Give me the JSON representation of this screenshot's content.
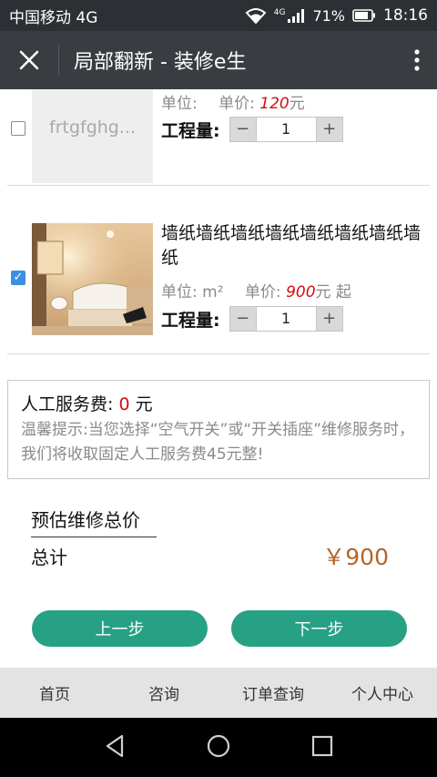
{
  "status_bar": {
    "carrier": "中国移动 4G",
    "network": "4G",
    "battery": "71%",
    "time": "18:16"
  },
  "title_bar": {
    "title": "局部翻新 - 装修e生"
  },
  "items": [
    {
      "name": "frtgfghghjhgjhj",
      "image_text": "frtgfghg...",
      "checked": false,
      "unit_label": "单位:",
      "unit": "",
      "price_label": "单价:",
      "price": "120",
      "price_suffix": "元",
      "qty_label": "工程量:",
      "qty": "1",
      "minus": "−",
      "plus": "+"
    },
    {
      "name": "墙纸墙纸墙纸墙纸墙纸墙纸墙纸墙纸",
      "checked": true,
      "unit_label": "单位:",
      "unit": "m²",
      "price_label": "单价:",
      "price": "900",
      "price_suffix": "元 起",
      "qty_label": "工程量:",
      "qty": "1",
      "minus": "−",
      "plus": "+"
    }
  ],
  "service": {
    "label": "人工服务费:",
    "value": "0",
    "unit": "元",
    "tip": "温馨提示:当您选择“空气开关”或“开关插座”维修服务时，我们将收取固定人工服务费45元整!"
  },
  "estimate": {
    "title": "预估维修总价",
    "total_label": "总计",
    "total_value": "￥900"
  },
  "buttons": {
    "prev": "上一步",
    "next": "下一步"
  },
  "tabs": [
    "首页",
    "咨询",
    "订单查询",
    "个人中心"
  ],
  "colors": {
    "accent": "#27a184",
    "price_red": "#d40d12",
    "total_brown": "#b4662a",
    "title_bar": "#393d41",
    "checkbox_blue": "#3d8fe3"
  }
}
